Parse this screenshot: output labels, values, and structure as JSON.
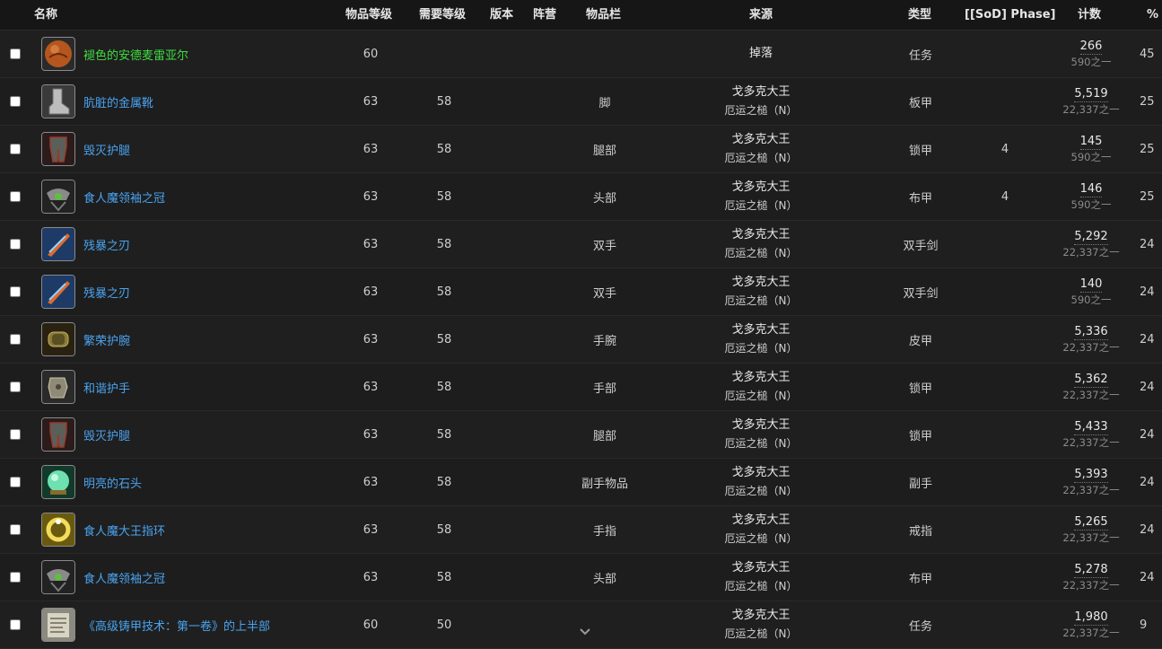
{
  "headers": {
    "name": "名称",
    "ilvl": "物品等级",
    "rlvl": "需要等级",
    "version": "版本",
    "faction": "阵营",
    "slot": "物品栏",
    "source": "来源",
    "type": "类型",
    "phase": "[[SoD] Phase]",
    "count": "计数",
    "pct": "%"
  },
  "rows": [
    {
      "name": "褪色的安德麦雷亚尔",
      "quality": "uncommon",
      "icon": "orb-icon",
      "ilvl": "60",
      "rlvl": "",
      "slot": "",
      "boss": "掉落",
      "zone": "",
      "type": "任务",
      "phase": "",
      "count": "266",
      "of": "590之一",
      "pct": "45"
    },
    {
      "name": "肮脏的金属靴",
      "quality": "rare",
      "icon": "boots-icon",
      "ilvl": "63",
      "rlvl": "58",
      "slot": "脚",
      "boss": "戈多克大王",
      "zone": "厄运之槌（N）",
      "type": "板甲",
      "phase": "",
      "count": "5,519",
      "of": "22,337之一",
      "pct": "25"
    },
    {
      "name": "毁灭护腿",
      "quality": "rare",
      "icon": "leggings-icon",
      "ilvl": "63",
      "rlvl": "58",
      "slot": "腿部",
      "boss": "戈多克大王",
      "zone": "厄运之槌（N）",
      "type": "锁甲",
      "phase": "4",
      "count": "145",
      "of": "590之一",
      "pct": "25"
    },
    {
      "name": "食人魔领袖之冠",
      "quality": "rare",
      "icon": "crown-icon",
      "ilvl": "63",
      "rlvl": "58",
      "slot": "头部",
      "boss": "戈多克大王",
      "zone": "厄运之槌（N）",
      "type": "布甲",
      "phase": "4",
      "count": "146",
      "of": "590之一",
      "pct": "25"
    },
    {
      "name": "残暴之刃",
      "quality": "rare",
      "icon": "blade-icon",
      "ilvl": "63",
      "rlvl": "58",
      "slot": "双手",
      "boss": "戈多克大王",
      "zone": "厄运之槌（N）",
      "type": "双手剑",
      "phase": "",
      "count": "5,292",
      "of": "22,337之一",
      "pct": "24"
    },
    {
      "name": "残暴之刃",
      "quality": "rare",
      "icon": "blade-icon",
      "ilvl": "63",
      "rlvl": "58",
      "slot": "双手",
      "boss": "戈多克大王",
      "zone": "厄运之槌（N）",
      "type": "双手剑",
      "phase": "",
      "count": "140",
      "of": "590之一",
      "pct": "24"
    },
    {
      "name": "繁荣护腕",
      "quality": "rare",
      "icon": "bracer-icon",
      "ilvl": "63",
      "rlvl": "58",
      "slot": "手腕",
      "boss": "戈多克大王",
      "zone": "厄运之槌（N）",
      "type": "皮甲",
      "phase": "",
      "count": "5,336",
      "of": "22,337之一",
      "pct": "24"
    },
    {
      "name": "和谐护手",
      "quality": "rare",
      "icon": "gauntlet-icon",
      "ilvl": "63",
      "rlvl": "58",
      "slot": "手部",
      "boss": "戈多克大王",
      "zone": "厄运之槌（N）",
      "type": "锁甲",
      "phase": "",
      "count": "5,362",
      "of": "22,337之一",
      "pct": "24"
    },
    {
      "name": "毁灭护腿",
      "quality": "rare",
      "icon": "leggings-icon",
      "ilvl": "63",
      "rlvl": "58",
      "slot": "腿部",
      "boss": "戈多克大王",
      "zone": "厄运之槌（N）",
      "type": "锁甲",
      "phase": "",
      "count": "5,433",
      "of": "22,337之一",
      "pct": "24"
    },
    {
      "name": "明亮的石头",
      "quality": "rare",
      "icon": "gem-icon",
      "ilvl": "63",
      "rlvl": "58",
      "slot": "副手物品",
      "boss": "戈多克大王",
      "zone": "厄运之槌（N）",
      "type": "副手",
      "phase": "",
      "count": "5,393",
      "of": "22,337之一",
      "pct": "24"
    },
    {
      "name": "食人魔大王指环",
      "quality": "rare",
      "icon": "ring-icon",
      "ilvl": "63",
      "rlvl": "58",
      "slot": "手指",
      "boss": "戈多克大王",
      "zone": "厄运之槌（N）",
      "type": "戒指",
      "phase": "",
      "count": "5,265",
      "of": "22,337之一",
      "pct": "24"
    },
    {
      "name": "食人魔领袖之冠",
      "quality": "rare",
      "icon": "crown-icon",
      "ilvl": "63",
      "rlvl": "58",
      "slot": "头部",
      "boss": "戈多克大王",
      "zone": "厄运之槌（N）",
      "type": "布甲",
      "phase": "",
      "count": "5,278",
      "of": "22,337之一",
      "pct": "24"
    },
    {
      "name": "《高级铸甲技术：第一卷》的上半部",
      "quality": "rare",
      "icon": "scroll-icon",
      "ilvl": "60",
      "rlvl": "50",
      "slot": "",
      "boss": "戈多克大王",
      "zone": "厄运之槌（N）",
      "type": "任务",
      "phase": "",
      "count": "1,980",
      "of": "22,337之一",
      "pct": "9"
    }
  ],
  "colors": {
    "link": "#4aa3f0",
    "uncommon": "#3fdc3f"
  }
}
